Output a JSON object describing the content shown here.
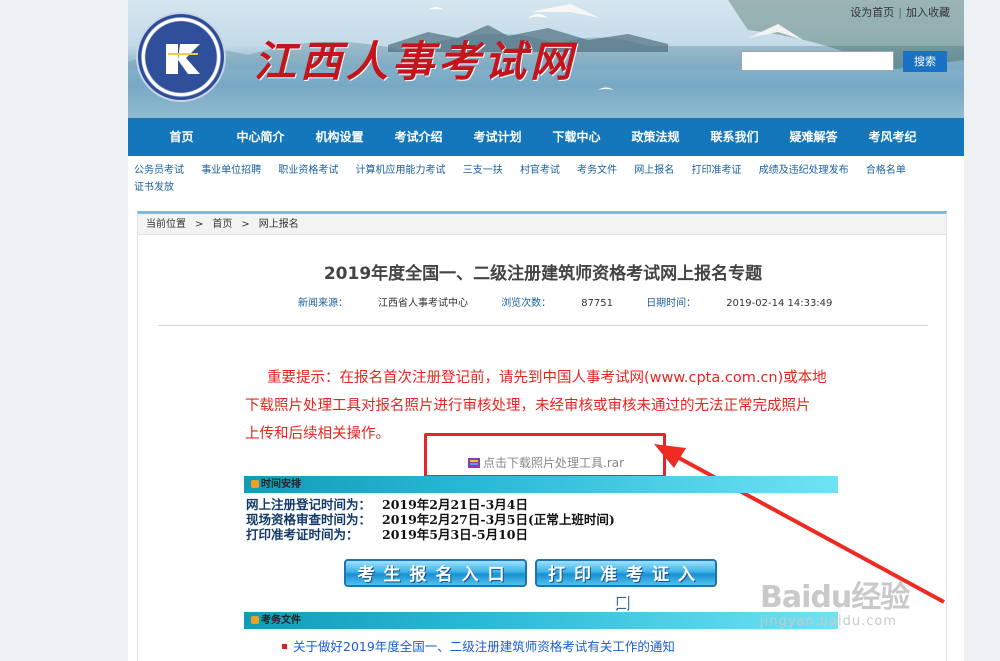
{
  "header": {
    "site_title": "江西人事考试网",
    "top_links": [
      "设为首页",
      "加入收藏"
    ],
    "search_button": "搜索"
  },
  "nav": [
    "首页",
    "中心简介",
    "机构设置",
    "考试介绍",
    "考试计划",
    "下载中心",
    "政策法规",
    "联系我们",
    "疑难解答",
    "考风考纪"
  ],
  "subnav": [
    "公务员考试",
    "事业单位招聘",
    "职业资格考试",
    "计算机应用能力考试",
    "三支一扶",
    "村官考试",
    "考务文件",
    "网上报名",
    "打印准考证",
    "成绩及违纪处理发布",
    "合格名单",
    "证书发放"
  ],
  "breadcrumb": {
    "label": "当前位置",
    "items": [
      "首页",
      "网上报名"
    ]
  },
  "article": {
    "title": "2019年度全国一、二级注册建筑师资格考试网上报名专题",
    "source_label": "新闻来源：",
    "source": "江西省人事考试中心",
    "views_label": "浏览次数：",
    "views": "87751",
    "date_label": "日期时间：",
    "date": "2019-02-14 14:33:49"
  },
  "notice": {
    "line1": "重要提示：在报名首次注册登记前，请先到中国人事考试网(www.cpta.com.cn)或本地",
    "line2": "下载照片处理工具对报名照片进行审核处理，未经审核或审核未通过的无法正常完成照片",
    "line3": "上传和后续相关操作。"
  },
  "download": {
    "label": "点击下载照片处理工具.rar"
  },
  "schedule": {
    "section_title": "时间安排",
    "rows": [
      {
        "key": "网上注册登记时间为：",
        "value": "2019年2月21日-3月4日"
      },
      {
        "key": "现场资格审查时间为：",
        "value": "2019年2月27日-3月5日(正常上班时间)"
      },
      {
        "key": "打印准考证时间为：",
        "value": "2019年5月3日-5月10日"
      }
    ]
  },
  "buttons": {
    "register": "考生报名入口",
    "print": "打印准考证入口"
  },
  "docs": {
    "section_title": "考务文件",
    "items": [
      "关于做好2019年度全国一、二级注册建筑师资格考试有关工作的通知"
    ]
  },
  "watermark": {
    "line1": "Baidu经验",
    "line2": "jingyan.baidu.com"
  },
  "colors": {
    "nav_bg": "#1477bb",
    "notice_red": "#e8251f",
    "highlight_red": "#e4262c",
    "title_red": "#c4151c"
  }
}
